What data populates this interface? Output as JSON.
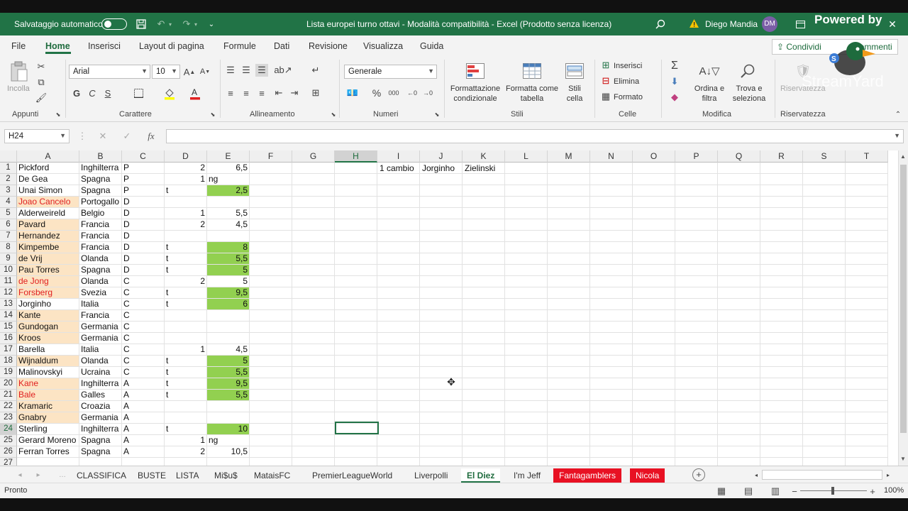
{
  "titlebar": {
    "autosave_label": "Salvataggio automatico",
    "doc_title": "Lista europei turno ottavi  -  Modalità compatibilità  -  Excel (Prodotto senza licenza)",
    "user_name": "Diego Mandia",
    "user_initials": "DM"
  },
  "tabs": [
    "File",
    "Home",
    "Inserisci",
    "Layout di pagina",
    "Formule",
    "Dati",
    "Revisione",
    "Visualizza",
    "Guida"
  ],
  "share_label": "Condividi",
  "comments_label": "Commenti",
  "ribbon": {
    "paste_label": "Incolla",
    "font_name": "Arial",
    "font_size": "10",
    "bold": "G",
    "italic": "C",
    "underline": "S",
    "number_format": "Generale",
    "cond_format": "Formattazione condizionale",
    "format_table": "Formatta come tabella",
    "cell_styles": "Stili cella",
    "insert": "Inserisci",
    "delete": "Elimina",
    "format": "Formato",
    "sort_filter": "Ordina e filtra",
    "find_select": "Trova e seleziona",
    "reserved": "Riservatezza",
    "groups": {
      "clipboard": "Appunti",
      "font": "Carattere",
      "alignment": "Allineamento",
      "number": "Numeri",
      "styles": "Stili",
      "cells": "Celle",
      "editing": "Modifica",
      "privacy": "Riservatezza"
    }
  },
  "formula": {
    "namebox": "H24",
    "fx": "fx",
    "content": ""
  },
  "columns": [
    "A",
    "B",
    "C",
    "D",
    "E",
    "F",
    "G",
    "H",
    "I",
    "J",
    "K",
    "L",
    "M",
    "N",
    "O",
    "P",
    "Q",
    "R",
    "S",
    "T"
  ],
  "selected_column": "H",
  "selected_row": "24",
  "rows": [
    {
      "n": "1",
      "a": "Pickford",
      "b": "Inghilterra",
      "c": "P",
      "d": "",
      "dn": "2",
      "e": "6,5",
      "f": "",
      "hl": false,
      "red": false,
      "green": false
    },
    {
      "n": "2",
      "a": "De Gea",
      "b": "Spagna",
      "c": "P",
      "d": "",
      "dn": "1",
      "e": "ng",
      "f": "",
      "hl": false,
      "red": false,
      "green": false,
      "eleft": true
    },
    {
      "n": "3",
      "a": "Unai Simon",
      "b": "Spagna",
      "c": "P",
      "d": "t",
      "dn": "",
      "e": "2,5",
      "f": "",
      "hl": false,
      "red": false,
      "green": true
    },
    {
      "n": "4",
      "a": "Joao Cancelo",
      "b": "Portogallo",
      "c": "D",
      "d": "",
      "dn": "",
      "e": "",
      "f": "",
      "hl": true,
      "red": true,
      "green": false
    },
    {
      "n": "5",
      "a": "Alderweireld",
      "b": "Belgio",
      "c": "D",
      "d": "",
      "dn": "1",
      "e": "5,5",
      "f": "",
      "hl": false,
      "red": false,
      "green": false
    },
    {
      "n": "6",
      "a": "Pavard",
      "b": "Francia",
      "c": "D",
      "d": "",
      "dn": "2",
      "e": "4,5",
      "f": "",
      "hl": true,
      "red": false,
      "green": false
    },
    {
      "n": "7",
      "a": "Hernandez",
      "b": "Francia",
      "c": "D",
      "d": "",
      "dn": "",
      "e": "",
      "f": "",
      "hl": true,
      "red": false,
      "green": false
    },
    {
      "n": "8",
      "a": "Kimpembe",
      "b": "Francia",
      "c": "D",
      "d": "t",
      "dn": "",
      "e": "8",
      "f": "",
      "hl": true,
      "red": false,
      "green": true
    },
    {
      "n": "9",
      "a": "de Vrij",
      "b": "Olanda",
      "c": "D",
      "d": "t",
      "dn": "",
      "e": "5,5",
      "f": "",
      "hl": true,
      "red": false,
      "green": true
    },
    {
      "n": "10",
      "a": "Pau Torres",
      "b": "Spagna",
      "c": "D",
      "d": "t",
      "dn": "",
      "e": "5",
      "f": "",
      "hl": true,
      "red": false,
      "green": true
    },
    {
      "n": "11",
      "a": "de Jong",
      "b": "Olanda",
      "c": "C",
      "d": "",
      "dn": "2",
      "e": "5",
      "f": "",
      "hl": true,
      "red": true,
      "green": false
    },
    {
      "n": "12",
      "a": "Forsberg",
      "b": "Svezia",
      "c": "C",
      "d": "t",
      "dn": "",
      "e": "9,5",
      "f": "",
      "hl": true,
      "red": true,
      "green": true
    },
    {
      "n": "13",
      "a": "Jorginho",
      "b": "Italia",
      "c": "C",
      "d": "t",
      "dn": "",
      "e": "6",
      "f": "",
      "hl": false,
      "red": false,
      "green": true
    },
    {
      "n": "14",
      "a": "Kante",
      "b": "Francia",
      "c": "C",
      "d": "",
      "dn": "",
      "e": "",
      "f": "",
      "hl": true,
      "red": false,
      "green": false
    },
    {
      "n": "15",
      "a": "Gundogan",
      "b": "Germania",
      "c": "C",
      "d": "",
      "dn": "",
      "e": "",
      "f": "",
      "hl": true,
      "red": false,
      "green": false
    },
    {
      "n": "16",
      "a": "Kroos",
      "b": "Germania",
      "c": "C",
      "d": "",
      "dn": "",
      "e": "",
      "f": "",
      "hl": true,
      "red": false,
      "green": false
    },
    {
      "n": "17",
      "a": "Barella",
      "b": "Italia",
      "c": "C",
      "d": "",
      "dn": "1",
      "e": "4,5",
      "f": "",
      "hl": false,
      "red": false,
      "green": false
    },
    {
      "n": "18",
      "a": "Wijnaldum",
      "b": "Olanda",
      "c": "C",
      "d": "t",
      "dn": "",
      "e": "5",
      "f": "",
      "hl": true,
      "red": false,
      "green": true
    },
    {
      "n": "19",
      "a": "Malinovskyi",
      "b": "Ucraina",
      "c": "C",
      "d": "t",
      "dn": "",
      "e": "5,5",
      "f": "",
      "hl": false,
      "red": false,
      "green": true
    },
    {
      "n": "20",
      "a": "Kane",
      "b": "Inghilterra",
      "c": "A",
      "d": "t",
      "dn": "",
      "e": "9,5",
      "f": "",
      "hl": true,
      "red": true,
      "green": true
    },
    {
      "n": "21",
      "a": "Bale",
      "b": "Galles",
      "c": "A",
      "d": "t",
      "dn": "",
      "e": "5,5",
      "f": "",
      "hl": true,
      "red": true,
      "green": true
    },
    {
      "n": "22",
      "a": "Kramaric",
      "b": "Croazia",
      "c": "A",
      "d": "",
      "dn": "",
      "e": "",
      "f": "",
      "hl": true,
      "red": false,
      "green": false
    },
    {
      "n": "23",
      "a": "Gnabry",
      "b": "Germania",
      "c": "A",
      "d": "",
      "dn": "",
      "e": "",
      "f": "",
      "hl": true,
      "red": false,
      "green": false
    },
    {
      "n": "24",
      "a": "Sterling",
      "b": "Inghilterra",
      "c": "A",
      "d": "t",
      "dn": "",
      "e": "10",
      "f": "",
      "hl": false,
      "red": false,
      "green": true
    },
    {
      "n": "25",
      "a": "Gerard Moreno",
      "b": "Spagna",
      "c": "A",
      "d": "",
      "dn": "1",
      "e": "ng",
      "f": "",
      "hl": false,
      "red": false,
      "green": false,
      "eleft": true
    },
    {
      "n": "26",
      "a": "Ferran Torres",
      "b": "Spagna",
      "c": "A",
      "d": "",
      "dn": "2",
      "e": "10,5",
      "f": "",
      "hl": false,
      "red": false,
      "green": false
    },
    {
      "n": "27",
      "a": "",
      "b": "",
      "c": "",
      "d": "",
      "dn": "",
      "e": "",
      "f": "",
      "hl": false,
      "red": false,
      "green": false
    }
  ],
  "extra_cells": {
    "i1": "1 cambio",
    "j1": "Jorginho",
    "k1": "Zielinski"
  },
  "sheets": [
    "CLASSIFICA",
    "BUSTE",
    "LISTA",
    "Mi$u$",
    "MataisFC",
    "PremierLeagueWorld",
    "Liverpolli",
    "El Diez",
    "I'm Jeff",
    "Fantagamblers",
    "Nicola"
  ],
  "active_sheet": "El Diez",
  "red_sheets": [
    "Fantagamblers",
    "Nicola"
  ],
  "status": {
    "ready": "Pronto",
    "zoom": "100%"
  },
  "watermark": {
    "line1": "Powered by",
    "line2": "StreamYard"
  },
  "colors": {
    "excel_green": "#217346",
    "highlight": "#fce4c4",
    "green_fill": "#92d050",
    "red_text": "#e02020",
    "red_tab": "#e81123"
  }
}
